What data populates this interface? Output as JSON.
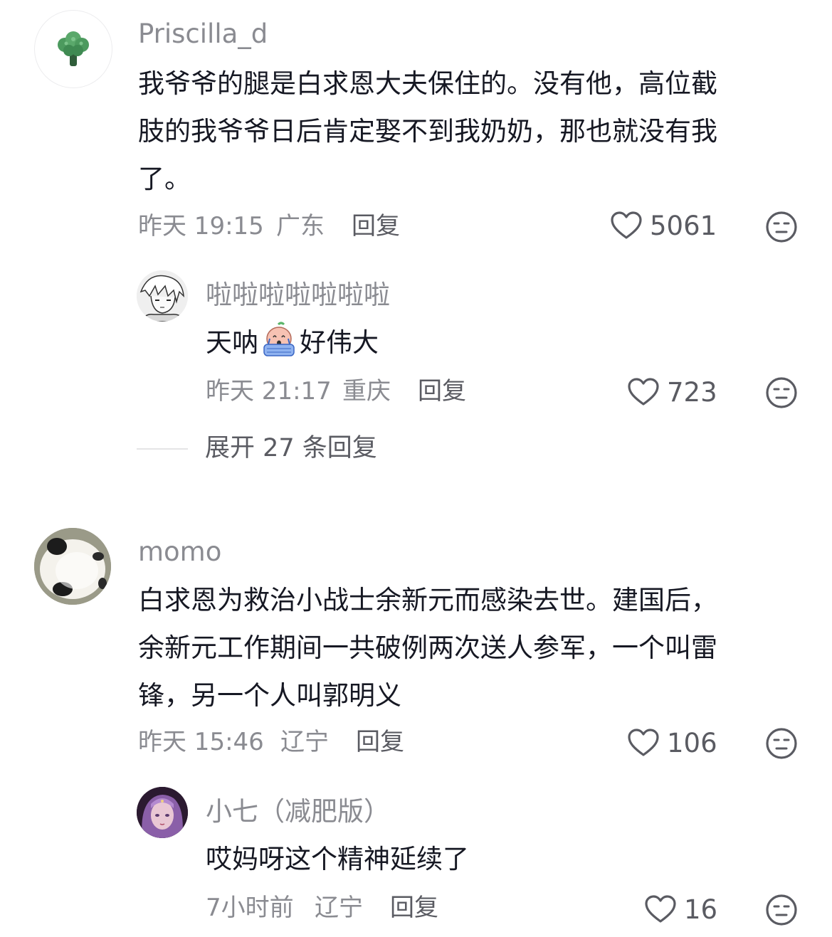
{
  "comments": [
    {
      "username": "Priscilla_d",
      "avatar_icon": "broccoli-icon",
      "text_lines": [
        "我爷爷的腿是白求恩大夫保住的。没有他，高位截",
        "肢的我爷爷日后肯定娶不到我奶奶，那也就没有我",
        "了。"
      ],
      "time": "昨天 19:15",
      "location": "广东",
      "reply_label": "回复",
      "likes": "5061",
      "replies": [
        {
          "username": "啦啦啦啦啦啦啦",
          "avatar_icon": "anime-avatar-icon",
          "text_before_emoji": "天呐",
          "emoji_icon": "crying-emoji-icon",
          "text_after_emoji": "好伟大",
          "time": "昨天 21:17",
          "location": "重庆",
          "reply_label": "回复",
          "likes": "723"
        }
      ],
      "expand_label": "展开 27 条回复"
    },
    {
      "username": "momo",
      "avatar_icon": "panda-plush-icon",
      "text_lines": [
        "白求恩为救治小战士余新元而感染去世。建国后，",
        "余新元工作期间一共破例两次送人参军，一个叫雷",
        "锋，另一个人叫郭明义"
      ],
      "time": "昨天 15:46",
      "location": "辽宁",
      "reply_label": "回复",
      "likes": "106",
      "replies": [
        {
          "username": "小七（减肥版）",
          "avatar_icon": "portrait-avatar-icon",
          "text": "哎妈呀这个精神延续了",
          "time": "7小时前",
          "location": "辽宁",
          "reply_label": "回复",
          "likes": "16"
        }
      ]
    }
  ],
  "icons": {
    "like": "heart-outline-icon",
    "dislike": "meh-face-icon"
  },
  "colors": {
    "text_primary": "#161823",
    "text_secondary": "#8a8b91",
    "action": "#5a5b62"
  }
}
